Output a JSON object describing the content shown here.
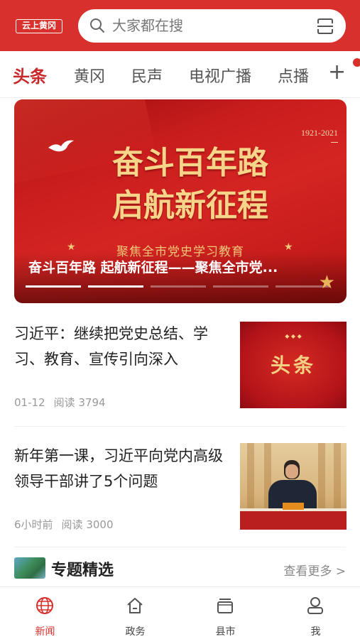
{
  "header": {
    "logo_text": "云上黄冈",
    "search_placeholder": "大家都在搜",
    "brand_color": "#d8302c"
  },
  "tabs": [
    {
      "label": "头条",
      "active": true
    },
    {
      "label": "黄冈",
      "active": false
    },
    {
      "label": "民声",
      "active": false
    },
    {
      "label": "电视广播",
      "active": false
    },
    {
      "label": "点播",
      "active": false
    }
  ],
  "tab_add_label": "+",
  "banner": {
    "year_range": "1921-2021",
    "headline_line1": "奋斗百年路",
    "headline_line2": "启航新征程",
    "subtitle": "聚焦全市党史学习教育",
    "caption": "奋斗百年路 起航新征程——聚焦全市党...",
    "slide_count": 5,
    "active_slide": 1
  },
  "news": [
    {
      "title": "习近平：继续把党史总结、学习、教育、宣传引向深入",
      "date": "01-12",
      "reads": "阅读 3794",
      "thumb_text": "头条"
    },
    {
      "title": "新年第一课，习近平向党内高级领导干部讲了5个问题",
      "date": "6小时前",
      "reads": "阅读 3000"
    }
  ],
  "section": {
    "title": "专题精选",
    "more": "查看更多 >"
  },
  "bottom_nav": [
    {
      "label": "新闻",
      "icon": "globe-icon",
      "active": true
    },
    {
      "label": "政务",
      "icon": "home-icon",
      "active": false
    },
    {
      "label": "县市",
      "icon": "layers-icon",
      "active": false
    },
    {
      "label": "我",
      "icon": "user-icon",
      "active": false
    }
  ]
}
